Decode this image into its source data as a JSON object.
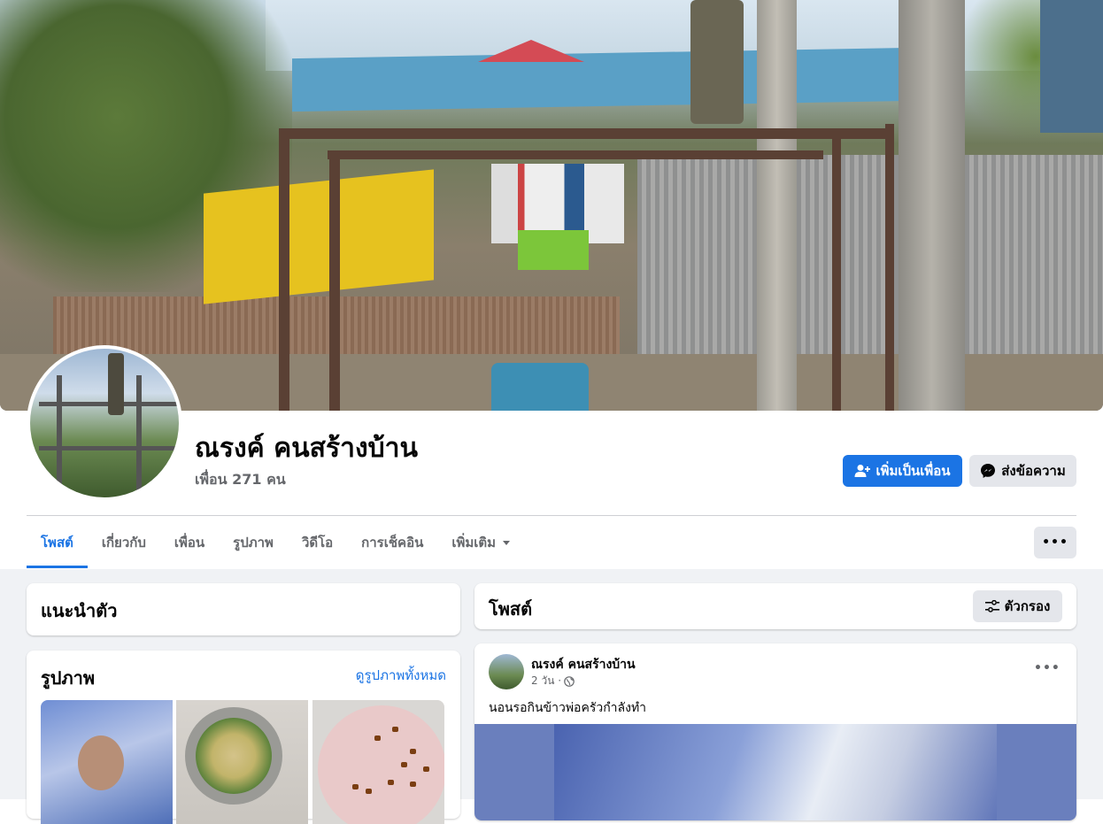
{
  "profile": {
    "name": "ณรงค์ คนสร้างบ้าน",
    "friends": "เพื่อน 271 คน"
  },
  "actions": {
    "add_friend": "เพิ่มเป็นเพื่อน",
    "message": "ส่งข้อความ",
    "more": "•••"
  },
  "tabs": [
    {
      "label": "โพสต์",
      "active": true
    },
    {
      "label": "เกี่ยวกับ"
    },
    {
      "label": "เพื่อน"
    },
    {
      "label": "รูปภาพ"
    },
    {
      "label": "วิดีโอ"
    },
    {
      "label": "การเช็คอิน"
    },
    {
      "label": "เพิ่มเติม"
    }
  ],
  "intro": {
    "title": "แนะนำตัว"
  },
  "photos": {
    "title": "รูปภาพ",
    "see_all": "ดูรูปภาพทั้งหมด"
  },
  "posts_header": {
    "title": "โพสต์",
    "filter": "ตัวกรอง"
  },
  "post": {
    "author": "ณรงค์ คนสร้างบ้าน",
    "time": "2 วัน ·",
    "text": "นอนรอกินข้าวพ่อครัวกำลังทำ",
    "more": "•••"
  },
  "colors": {
    "accent": "#1b74e4",
    "secondary_button": "#e4e6eb",
    "page_background": "#f0f2f5",
    "muted_text": "#65676b"
  },
  "icons": [
    "add-friend-icon",
    "messenger-icon",
    "caret-down-icon",
    "filter-icon",
    "globe-icon",
    "more-dots-icon"
  ]
}
